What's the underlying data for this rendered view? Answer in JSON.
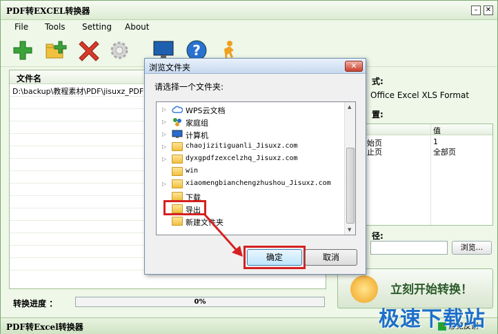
{
  "app": {
    "title": "PDF转EXCEL转换器",
    "menu": [
      "File",
      "Tools",
      "Setting",
      "About"
    ],
    "file_list_header": "文件名",
    "file_list_items": [
      "D:\\backup\\教程素材\\PDF\\jisuxz_PDF"
    ],
    "progress_label": "转换进度 ：",
    "progress_value": "0%",
    "status_text": "PDF转Excel转换器",
    "feedback": "意见反馈",
    "watermark": "极速下载站"
  },
  "right": {
    "format_label": "式:",
    "format_value": "Office Excel XLS Format",
    "settings_label": "置:",
    "table_header_value": "值",
    "rows": [
      {
        "key": "始页",
        "value": "1"
      },
      {
        "key": "止页",
        "value": "全部页"
      }
    ],
    "output_label": "径:",
    "browse": "浏览...",
    "start": "立刻开始转换！"
  },
  "dialog": {
    "title": "浏览文件夹",
    "prompt": "请选择一个文件夹:",
    "tree": [
      {
        "label": "WPS云文档",
        "icon": "cloud-icon",
        "expandable": true
      },
      {
        "label": "家庭组",
        "icon": "homegroup-icon",
        "expandable": true
      },
      {
        "label": "计算机",
        "icon": "computer-icon",
        "expandable": true
      },
      {
        "label": "chaojizitiguanli_Jisuxz.com",
        "icon": "folder-icon",
        "expandable": true
      },
      {
        "label": "dyxgpdfzexcelzhq_Jisuxz.com",
        "icon": "folder-icon",
        "expandable": true
      },
      {
        "label": "win",
        "icon": "folder-icon",
        "expandable": false
      },
      {
        "label": "xiaomengbianchengzhushou_Jisuxz.com",
        "icon": "folder-icon",
        "expandable": true
      },
      {
        "label": "下载",
        "icon": "folder-icon",
        "expandable": false
      },
      {
        "label": "导出",
        "icon": "folder-icon",
        "expandable": false,
        "selected": true
      },
      {
        "label": "新建文件夹",
        "icon": "folder-icon",
        "expandable": false
      }
    ],
    "ok": "确定",
    "cancel": "取消",
    "accent": "#d62020"
  }
}
